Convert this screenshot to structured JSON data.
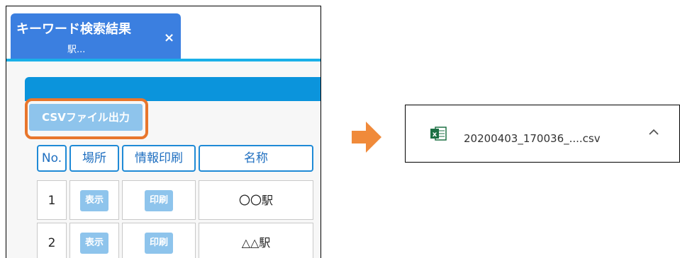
{
  "tab": {
    "title": "キーワード検索結果",
    "subtitle": "駅...",
    "close": "×"
  },
  "toolbar": {
    "csv_label": "CSVファイル出力"
  },
  "table": {
    "headers": [
      "No.",
      "場所",
      "情報印刷",
      "名称"
    ],
    "rows": [
      {
        "no": "1",
        "place_btn": "表示",
        "print_btn": "印刷",
        "name": "〇〇駅"
      },
      {
        "no": "2",
        "place_btn": "表示",
        "print_btn": "印刷",
        "name": "△△駅"
      }
    ]
  },
  "download": {
    "filename": "20200403_170036_....csv",
    "icon": "excel-icon"
  },
  "colors": {
    "tab": "#3b7fe0",
    "accent": "#0b94dc",
    "highlight": "#e8762c",
    "button": "#8ec4ec"
  }
}
